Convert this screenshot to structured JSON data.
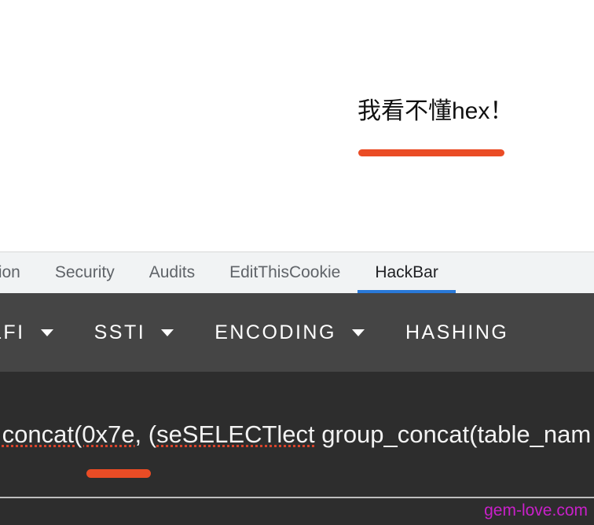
{
  "annotation": {
    "note_text": "我看不懂hex！",
    "highlight_color": "#ea4c25"
  },
  "devtools": {
    "tabs": [
      {
        "label": "tion",
        "active": false,
        "clipped": true
      },
      {
        "label": "Security",
        "active": false,
        "clipped": false
      },
      {
        "label": "Audits",
        "active": false,
        "clipped": false
      },
      {
        "label": "EditThisCookie",
        "active": false,
        "clipped": false
      },
      {
        "label": "HackBar",
        "active": true,
        "clipped": false
      }
    ],
    "active_tab_indicator_color": "#2979d8"
  },
  "hackbar": {
    "menus": [
      {
        "label": "LFI",
        "has_caret": true,
        "clipped": true
      },
      {
        "label": "SSTI",
        "has_caret": true,
        "clipped": false
      },
      {
        "label": "ENCODING",
        "has_caret": true,
        "clipped": false
      },
      {
        "label": "HASHING",
        "has_caret": false,
        "clipped": false
      }
    ],
    "payload": {
      "segment_1": ",",
      "segment_2_misspelled": "concat(0x7e,",
      "segment_3": " (",
      "segment_4_misspelled": "seSELECTlect",
      "segment_5": " group_concat(table_nam"
    },
    "watermark": "gem-love.com"
  }
}
